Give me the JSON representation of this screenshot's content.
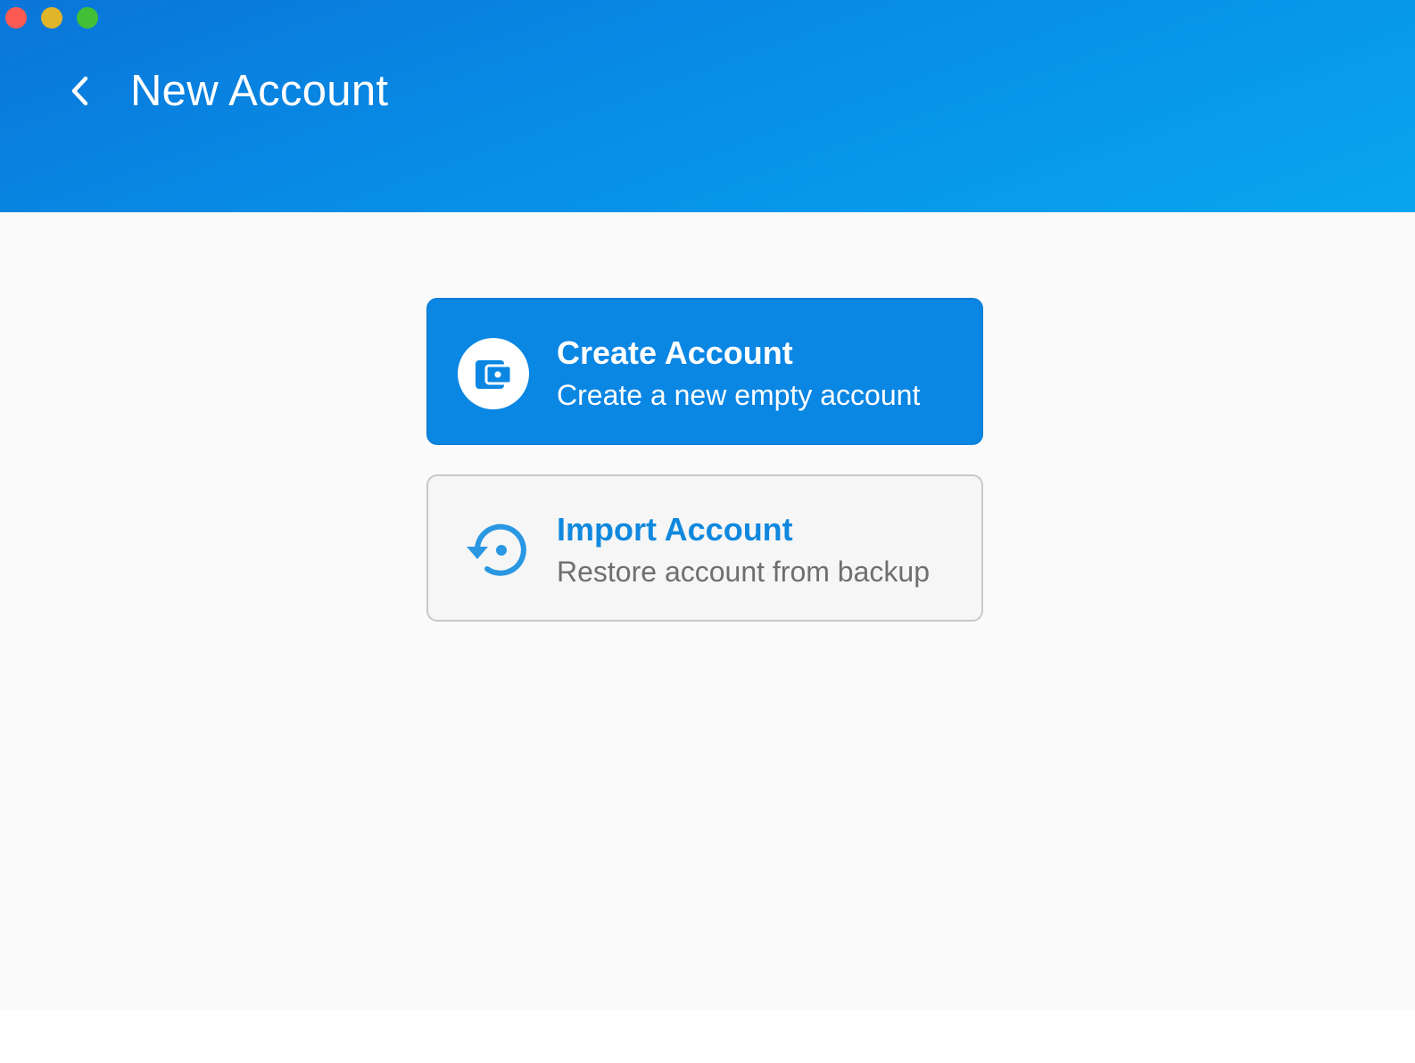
{
  "window": {
    "controls": [
      "close",
      "minimize",
      "zoom"
    ]
  },
  "header": {
    "back_icon": "chevron-left-icon",
    "title": "New Account"
  },
  "options": [
    {
      "title": "Create Account",
      "subtitle": "Create a new empty account",
      "icon": "wallet-icon"
    },
    {
      "title": "Import Account",
      "subtitle": "Restore account from backup",
      "icon": "restore-icon"
    }
  ],
  "colors": {
    "header_gradient_start": "#0a75d9",
    "header_gradient_end": "#08a6ee",
    "primary": "#0a86e3",
    "import_title": "#1088de",
    "muted_text": "#6f6f6f",
    "background": "#fafafa"
  }
}
